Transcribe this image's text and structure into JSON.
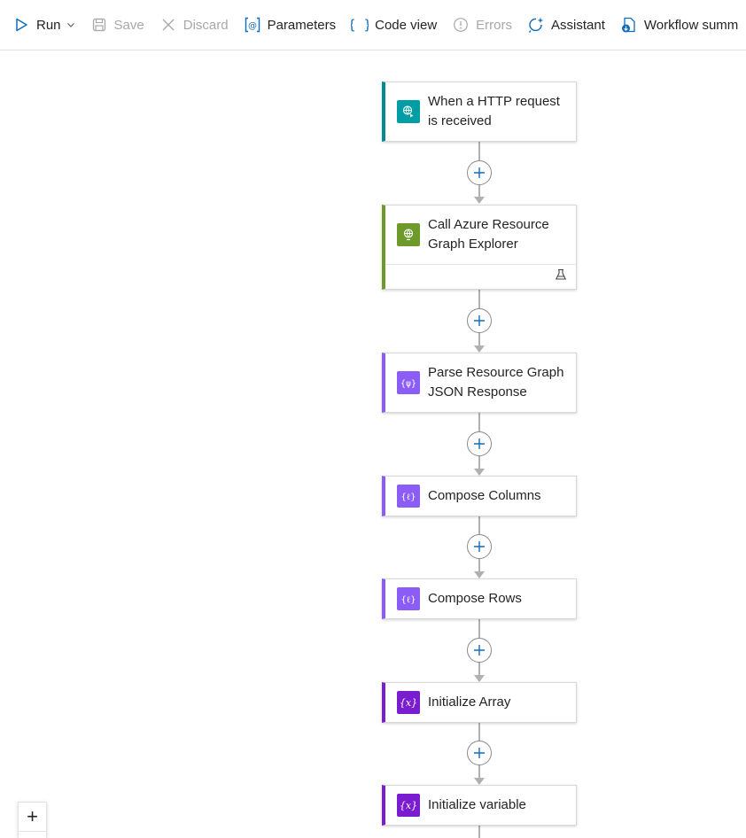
{
  "toolbar": {
    "run": "Run",
    "save": "Save",
    "discard": "Discard",
    "parameters": "Parameters",
    "code_view": "Code view",
    "errors": "Errors",
    "assistant": "Assistant",
    "workflow_summary": "Workflow summ"
  },
  "colors": {
    "accent": "#0f6cbd",
    "http": "#009ea4",
    "http_border": "#008b8f",
    "azure": "#6d9a2b",
    "parse": "#8b5cf6",
    "variable": "#7a1ccf"
  },
  "nodes": [
    {
      "title_line1": "When a HTTP request",
      "title_line2": "is received",
      "icon": "http-request-icon"
    },
    {
      "title_line1": "Call Azure Resource",
      "title_line2": "Graph Explorer",
      "icon": "azure-http-icon",
      "footer_icon": "test-flask-icon"
    },
    {
      "title_line1": "Parse Resource Graph",
      "title_line2": "JSON Response",
      "icon": "parse-json-icon"
    },
    {
      "title_line1": "Compose Columns",
      "icon": "compose-icon"
    },
    {
      "title_line1": "Compose Rows",
      "icon": "compose-icon"
    },
    {
      "title_line1": "Initialize Array",
      "icon": "variable-icon"
    },
    {
      "title_line1": "Initialize variable",
      "icon": "variable-icon"
    }
  ],
  "zoom": {
    "plus": "+"
  }
}
